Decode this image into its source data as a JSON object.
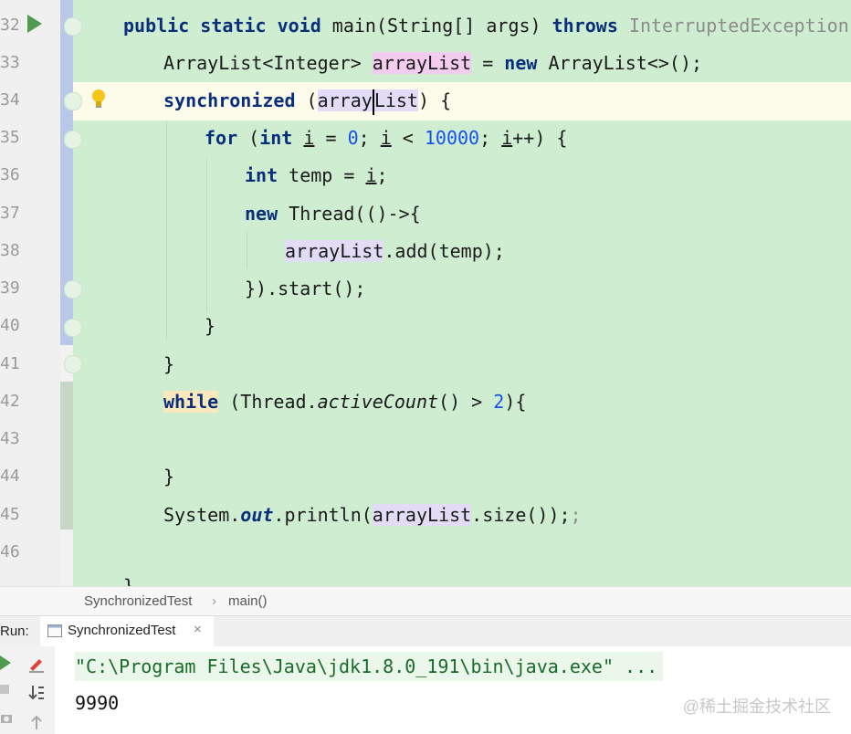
{
  "gutter": {
    "line_numbers": [
      "32",
      "33",
      "34",
      "35",
      "36",
      "37",
      "38",
      "39",
      "40",
      "41",
      "42",
      "43",
      "44",
      "45",
      "46"
    ]
  },
  "code": {
    "l32": {
      "kw1": "public static void",
      "t1": " main(String[] args) ",
      "kw2": "throws",
      "cmt": " InterruptedException",
      "t2": " {"
    },
    "l33": {
      "t1": "ArrayList<Integer> ",
      "var": "arrayList",
      "t2": " = ",
      "kw": "new",
      "t3": " ArrayList<>();"
    },
    "l34": {
      "kw": "synchronized",
      "t1": " (",
      "var_a": "array",
      "var_b": "List",
      "t2": ") {"
    },
    "l35": {
      "kw": "for",
      "t1": " (",
      "kw2": "int",
      "t2": " ",
      "i1": "i",
      "t3": " = ",
      "n1": "0",
      "t4": "; ",
      "i2": "i",
      "t5": " < ",
      "n2": "10000",
      "t6": "; ",
      "i3": "i",
      "t7": "++) {"
    },
    "l36": {
      "kw": "int",
      "t1": " temp = ",
      "i": "i",
      "t2": ";"
    },
    "l37": {
      "kw": "new",
      "t1": " Thread(()->{"
    },
    "l38": {
      "var": "arrayList",
      "t1": ".add(temp);"
    },
    "l39": {
      "t1": "}).start();"
    },
    "l40": {
      "t1": "}"
    },
    "l41": {
      "t1": "}"
    },
    "l42": {
      "kw": "while",
      "t1": " (Thread.",
      "it": "activeCount",
      "t2": "() > ",
      "n": "2",
      "t3": "){"
    },
    "l44": {
      "t1": "}"
    },
    "l45": {
      "t1": "System.",
      "it": "out",
      "t2": ".println(",
      "var": "arrayList",
      "t3": ".size());",
      "cmt": ";"
    },
    "l47": {
      "t1": "}"
    }
  },
  "breadcrumb": {
    "class_name": "SynchronizedTest",
    "sep": "›",
    "method": "main()"
  },
  "run": {
    "label": "Run:",
    "tab": "SynchronizedTest",
    "close": "×"
  },
  "console": {
    "command": "\"C:\\Program Files\\Java\\jdk1.8.0_191\\bin\\java.exe\" ...",
    "output": "9990"
  },
  "watermark": "@稀土掘金技术社区",
  "colors": {
    "code_bg": "#cfeed1",
    "keyword": "#0a2f7a",
    "number": "#1750eb",
    "run_green": "#4e9a4e"
  }
}
